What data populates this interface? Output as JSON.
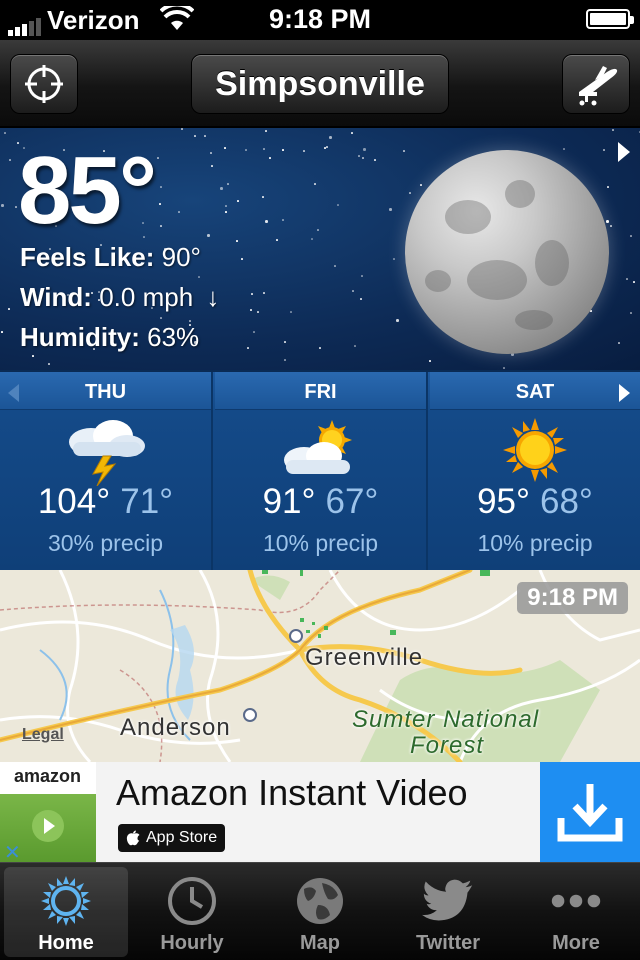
{
  "status_bar": {
    "carrier": "Verizon",
    "time": "9:18 PM",
    "signal_bars": 3,
    "battery_level": 1.0
  },
  "nav": {
    "city": "Simpsonville",
    "left_icon": "crosshair-icon",
    "right_icon": "airplane-icon"
  },
  "current": {
    "temperature": "85°",
    "feels_like_label": "Feels Like:",
    "feels_like_value": "90°",
    "wind_label": "Wind:",
    "wind_value": "0.0 mph",
    "wind_arrow": "↓",
    "humidity_label": "Humidity:",
    "humidity_value": "63%",
    "condition_icon": "moon-icon"
  },
  "forecast": {
    "days": [
      {
        "day": "THU",
        "high": "104°",
        "low": "71°",
        "precip": "30% precip",
        "icon": "thunderstorm-icon"
      },
      {
        "day": "FRI",
        "high": "91°",
        "low": "67°",
        "precip": "10% precip",
        "icon": "partly-cloudy-icon"
      },
      {
        "day": "SAT",
        "high": "95°",
        "low": "68°",
        "precip": "10% precip",
        "icon": "sunny-icon"
      }
    ]
  },
  "map": {
    "timestamp": "9:18 PM",
    "labels": [
      "Greenville",
      "Anderson",
      "Sumter National",
      "Forest"
    ],
    "legal": "Legal"
  },
  "ad": {
    "brand": "amazon",
    "title": "Amazon Instant Video",
    "badge": "App Store",
    "close": "✕",
    "accent_color": "#1e8ef2"
  },
  "tabs": [
    {
      "label": "Home",
      "icon": "sun-icon",
      "active": true
    },
    {
      "label": "Hourly",
      "icon": "clock-icon",
      "active": false
    },
    {
      "label": "Map",
      "icon": "globe-icon",
      "active": false
    },
    {
      "label": "Twitter",
      "icon": "twitter-bird-icon",
      "active": false
    },
    {
      "label": "More",
      "icon": "more-dots-icon",
      "active": false
    }
  ]
}
